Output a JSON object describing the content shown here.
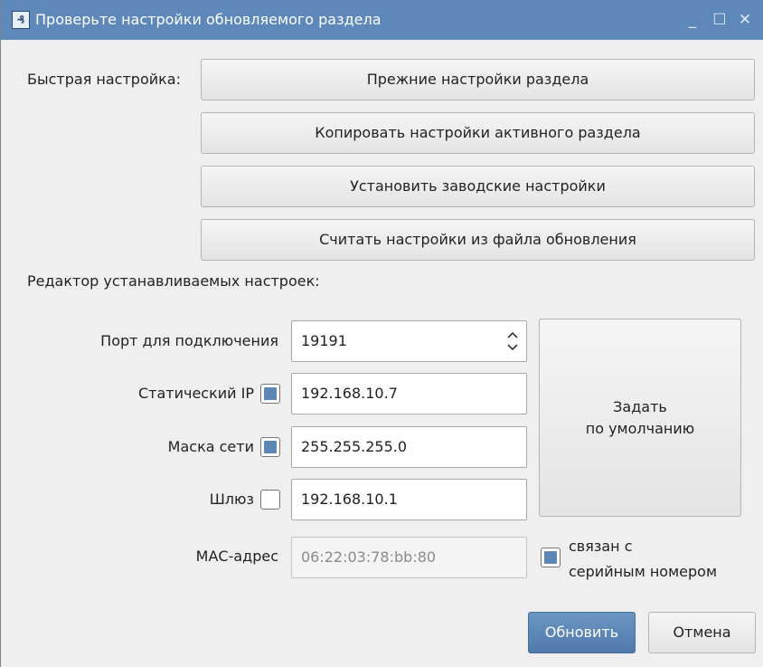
{
  "window": {
    "title": "Проверьте настройки обновляемого раздела"
  },
  "icons": {
    "app": "app-logo-icon",
    "minimize": "minimize-icon",
    "maximize": "maximize-icon",
    "close": "close-icon",
    "spin": "spin-arrows-icon"
  },
  "quick_setup": {
    "label": "Быстрая настройка:",
    "buttons": [
      "Прежние настройки раздела",
      "Копировать настройки активного раздела",
      "Установить заводские настройки",
      "Считать настройки из файла обновления"
    ]
  },
  "editor": {
    "label": "Редактор устанавливаемых настроек:",
    "port": {
      "label": "Порт для подключения",
      "value": "19191"
    },
    "static_ip": {
      "label": "Статический IP",
      "checked": true,
      "value": "192.168.10.7"
    },
    "netmask": {
      "label": "Маска сети",
      "checked": true,
      "value": "255.255.255.0"
    },
    "gateway": {
      "label": "Шлюз",
      "checked": false,
      "value": "192.168.10.1"
    },
    "mac": {
      "label": "МАС-адрес",
      "value": "06:22:03:78:bb:80",
      "serial_label_1": "связан с",
      "serial_label_2": "серийным номером",
      "serial_checked": true
    },
    "defaults_button": {
      "line1": "Задать",
      "line2": "по умолчанию"
    }
  },
  "footer": {
    "update": "Обновить",
    "cancel": "Отмена"
  },
  "colors": {
    "titlebar": "#5d88b9",
    "accent": "#5b86b6",
    "background": "#efefef"
  }
}
